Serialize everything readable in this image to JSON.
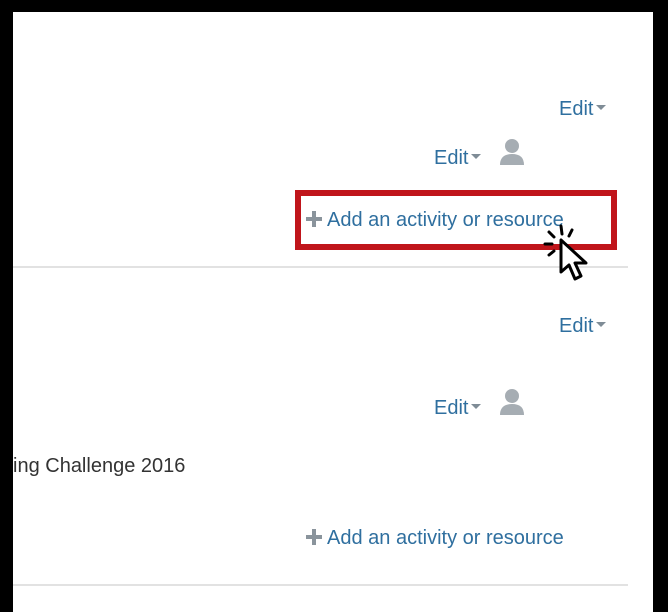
{
  "section1": {
    "edit_label": "Edit",
    "item_edit_label": "Edit",
    "add_label": "Add an activity or resource"
  },
  "section2": {
    "edit_label": "Edit",
    "item_edit_label": "Edit",
    "item_text": "ing Challenge 2016",
    "add_label": "Add an activity or resource"
  },
  "colors": {
    "link": "#2f6f9f",
    "highlight": "#c0151b"
  },
  "icons": [
    "caret-down-icon",
    "user-icon",
    "plus-icon",
    "pointer-cursor-icon"
  ]
}
